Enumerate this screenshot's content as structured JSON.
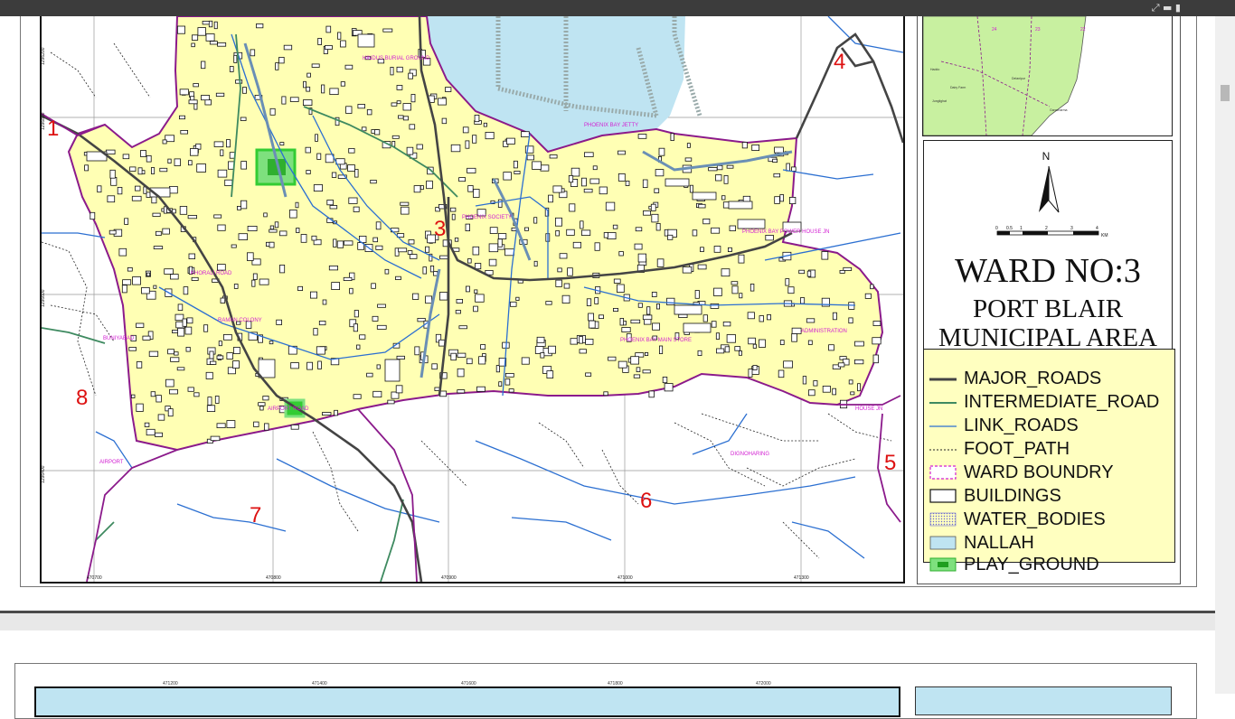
{
  "map": {
    "ward_labels": [
      {
        "id": "1",
        "text": "1"
      },
      {
        "id": "3",
        "text": "3"
      },
      {
        "id": "4",
        "text": "4"
      },
      {
        "id": "5",
        "text": "5"
      },
      {
        "id": "6",
        "text": "6"
      },
      {
        "id": "7",
        "text": "7"
      },
      {
        "id": "8",
        "text": "8"
      }
    ],
    "place_labels": [
      "HINDUS BURIAL GROUND",
      "PHOENIX BAY JETTY",
      "PHOENIX BAY POWER HOUSE JN",
      "KHORALI ROAD",
      "BUNIYABAD",
      "PHOENIX BAY MAIN STORE",
      "AIRPORT",
      "DIGNOHARING",
      "HOUSE JN",
      "AIRPORT ROAD",
      "PHOENIX SOCIETY",
      "RAMAN COLONY",
      "ADMINISTRATION"
    ],
    "x_ticks": [
      "470700",
      "470800",
      "470900",
      "471000",
      "471300"
    ],
    "y_ticks": [
      "1296800",
      "1296600",
      "1296400",
      "1296200"
    ]
  },
  "inset": {
    "numbers": [
      "24",
      "23",
      "22"
    ],
    "areas": [
      "Haddo",
      "Dairy Farm",
      "Junglighat",
      "Delanipur",
      "Garacharma"
    ]
  },
  "title": {
    "north_label": "N",
    "scale_ticks": [
      "0",
      "0.5",
      "1",
      "2",
      "3",
      "4"
    ],
    "scale_unit": "KM",
    "ward": "WARD NO:3",
    "line1": "PORT BLAIR",
    "line2": "MUNICIPAL AREA"
  },
  "legend": {
    "items": [
      {
        "label": "MAJOR_ROADS",
        "symbol": "major-road"
      },
      {
        "label": "INTERMEDIATE_ROAD",
        "symbol": "intermediate-road"
      },
      {
        "label": "LINK_ROADS",
        "symbol": "link-road"
      },
      {
        "label": "FOOT_PATH",
        "symbol": "foot-path"
      },
      {
        "label": "WARD BOUNDRY",
        "symbol": "ward-boundary"
      },
      {
        "label": "BUILDINGS",
        "symbol": "building"
      },
      {
        "label": "WATER_BODIES",
        "symbol": "water-body"
      },
      {
        "label": "NALLAH",
        "symbol": "nallah"
      },
      {
        "label": "PLAY_GROUND",
        "symbol": "play-ground"
      }
    ]
  },
  "page2": {
    "x_ticks": [
      "471200",
      "471400",
      "471600",
      "471800",
      "472000"
    ]
  },
  "colors": {
    "ward_fill": "#ffffb4",
    "water": "#bfe4f2",
    "major_road": "#444444",
    "intermediate_road": "#3e8a60",
    "link_road": "#2b6fd1",
    "boundary": "#8b1a8b",
    "label_red": "#dd1111",
    "label_magenta": "#d21fd2",
    "playground": "#33cc33"
  }
}
